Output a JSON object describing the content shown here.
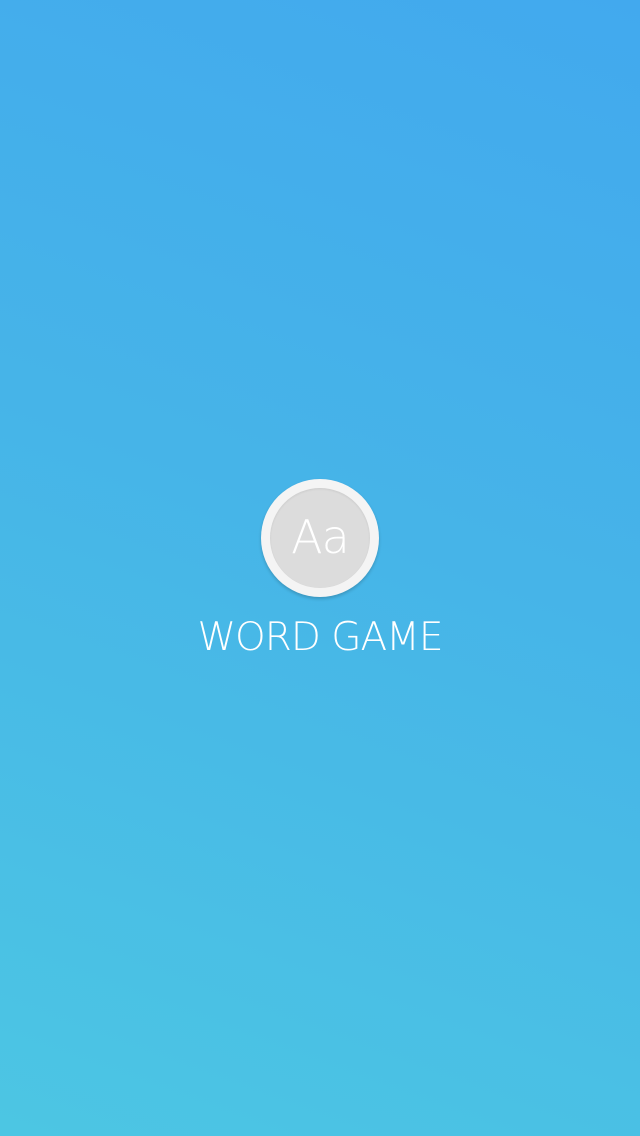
{
  "splash": {
    "logo_glyph": "Aa",
    "title": "WORD GAME",
    "background_colors": [
      "#42a9ee",
      "#4cc6e3"
    ],
    "logo_ring_color": "#f4f4f4",
    "logo_fill_color": "#dcdcdc",
    "text_color": "#ffffff"
  }
}
